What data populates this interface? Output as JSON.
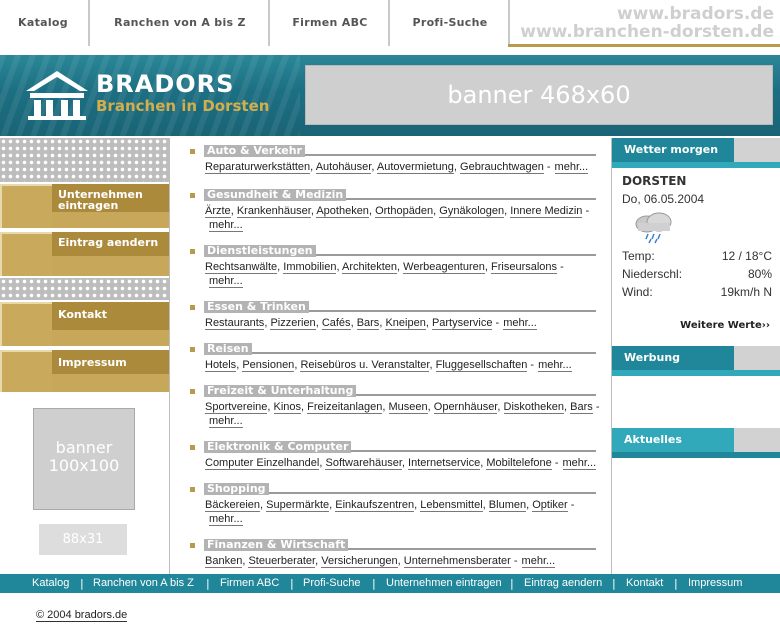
{
  "topnav": {
    "items": [
      "Katalog",
      "Ranchen von A bis Z",
      "Firmen ABC",
      "Profi-Suche"
    ],
    "domain1": "www.bradors.de",
    "domain2": "www.branchen-dorsten.de"
  },
  "header": {
    "brand_name": "BRADORS",
    "brand_sub": "Branchen in Dorsten",
    "banner_label": "banner 468x60"
  },
  "sidebar": {
    "menu": [
      "Unternehmen eintragen",
      "Eintrag aendern",
      "Kontakt",
      "Impressum"
    ],
    "banner100_line1": "banner",
    "banner100_line2": "100x100",
    "banner88": "88x31"
  },
  "categories": [
    {
      "title": "Auto & Verkehr",
      "links": [
        "Reparaturwerkstätten",
        "Autohäuser",
        "Autovermietung",
        "Gebrauchtwagen"
      ],
      "more": "mehr..."
    },
    {
      "title": "Gesundheit & Medizin",
      "links": [
        "Ärzte",
        "Krankenhäuser",
        "Apotheken",
        "Orthopäden",
        "Gynäkologen",
        "Innere Medizin"
      ],
      "more": "mehr..."
    },
    {
      "title": "Dienstleistungen",
      "links": [
        "Rechtsanwälte",
        "Immobilien",
        "Architekten",
        "Werbeagenturen",
        "Friseursalons"
      ],
      "more": "mehr..."
    },
    {
      "title": "Essen & Trinken",
      "links": [
        "Restaurants",
        "Pizzerien",
        "Cafés",
        "Bars",
        "Kneipen",
        "Partyservice"
      ],
      "more": "mehr..."
    },
    {
      "title": "Reisen",
      "links": [
        "Hotels",
        "Pensionen",
        "Reisebüros u. Veranstalter",
        "Fluggesellschaften"
      ],
      "more": "mehr..."
    },
    {
      "title": "Freizeit & Unterhaltung",
      "links": [
        "Sportvereine",
        "Kinos",
        "Freizeitanlagen",
        "Museen",
        "Opernhäuser",
        "Diskotheken",
        "Bars"
      ],
      "more": "mehr..."
    },
    {
      "title": "Elektronik & Computer",
      "links": [
        "Computer Einzelhandel",
        "Softwarehäuser",
        "Internetservice",
        "Mobiltelefone"
      ],
      "more": "mehr..."
    },
    {
      "title": "Shopping",
      "links": [
        "Bäckereien",
        "Supermärkte",
        "Einkaufszentren",
        "Lebensmittel",
        "Blumen",
        "Optiker"
      ],
      "more": "mehr..."
    },
    {
      "title": "Finanzen & Wirtschaft",
      "links": [
        "Banken",
        "Steuerberater",
        "Versicherungen",
        "Unternehmensberater"
      ],
      "more": "mehr..."
    }
  ],
  "weather": {
    "header": "Wetter morgen",
    "city": "DORSTEN",
    "date": "Do, 06.05.2004",
    "temp_label": "Temp:",
    "temp_value": "12 / 18°C",
    "rain_label": "Niederschl:",
    "rain_value": "80%",
    "wind_label": "Wind:",
    "wind_value": "19km/h N",
    "more": "Weitere Werte››",
    "icon": "rain-cloud-icon"
  },
  "right": {
    "werbung": "Werbung",
    "aktuelles": "Aktuelles"
  },
  "footer": {
    "items": [
      "Katalog",
      "Ranchen von A bis Z",
      "Firmen ABC",
      "Profi-Suche",
      "Unternehmen eintragen",
      "Eintrag aendern",
      "Kontakt",
      "Impressum"
    ],
    "separator": "|",
    "copyright": "© 2004  bradors.de"
  },
  "colors": {
    "teal": "#20879a",
    "gold": "#ab8a3c",
    "gray": "#b3b3b3"
  }
}
